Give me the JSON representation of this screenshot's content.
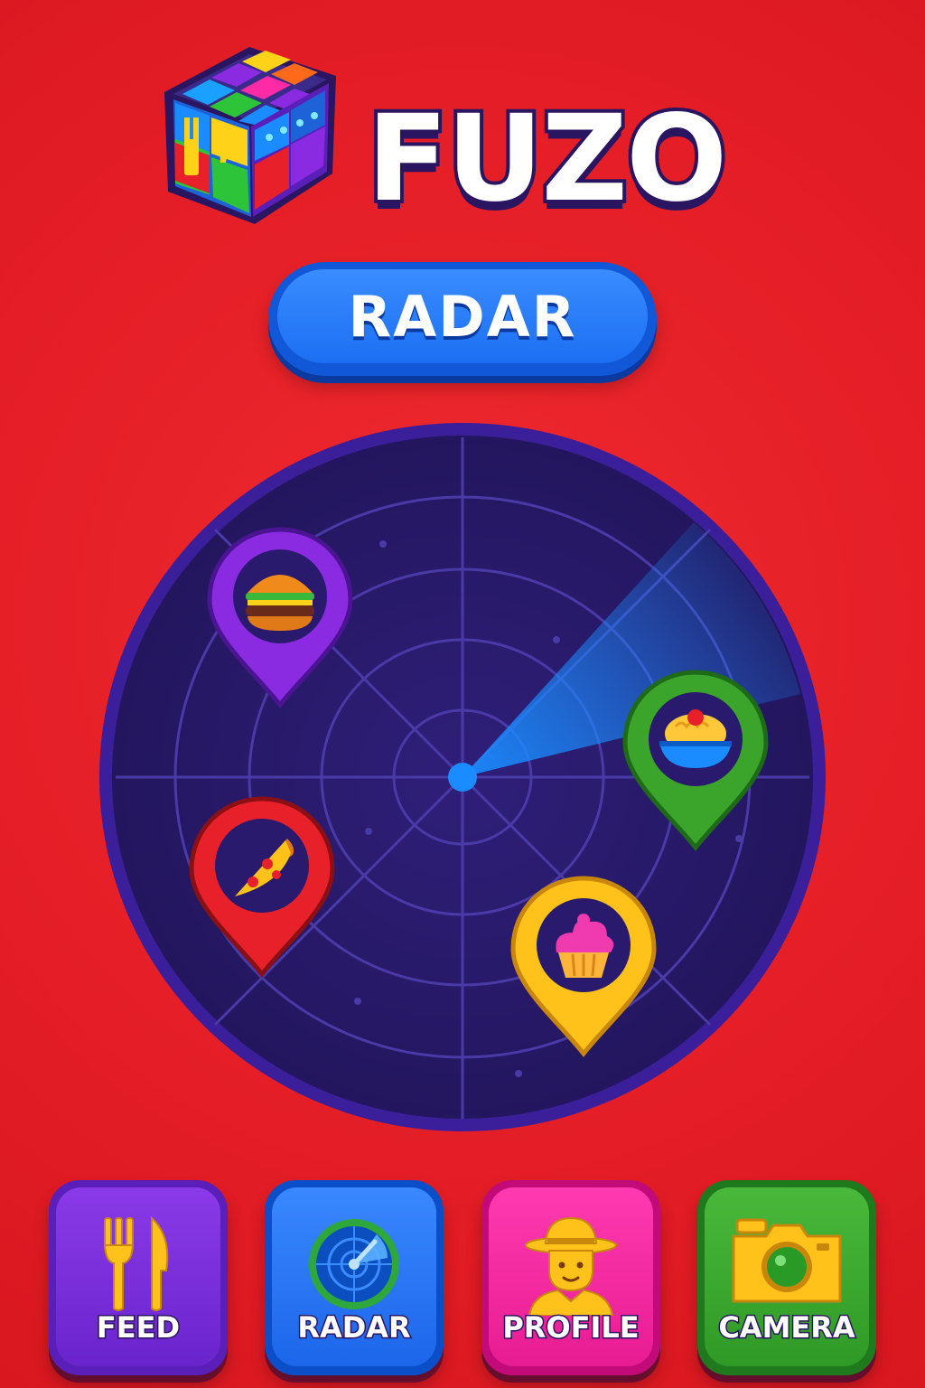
{
  "app": {
    "title": "FUZO"
  },
  "mode_pill": {
    "label": "RADAR"
  },
  "radar": {
    "pins": [
      {
        "name": "burger",
        "icon": "burger-icon",
        "color": "#8a2be2"
      },
      {
        "name": "noodles",
        "icon": "noodle-bowl-icon",
        "color": "#3aa52a"
      },
      {
        "name": "pizza",
        "icon": "pizza-slice-icon",
        "color": "#e8202a"
      },
      {
        "name": "cupcake",
        "icon": "cupcake-icon",
        "color": "#ffc21a"
      }
    ]
  },
  "nav": {
    "items": [
      {
        "label": "FEED",
        "icon": "fork-knife-icon",
        "color": "#7a2ee0"
      },
      {
        "label": "RADAR",
        "icon": "radar-icon",
        "color": "#2a78f4"
      },
      {
        "label": "PROFILE",
        "icon": "explorer-avatar-icon",
        "color": "#f22aa2"
      },
      {
        "label": "CAMERA",
        "icon": "camera-icon",
        "color": "#3ca830"
      }
    ]
  },
  "colors": {
    "background": "#e8202a",
    "radar_dish": "#2a1a6e",
    "accent_blue": "#1c6ff2",
    "outline": "#2a1560"
  }
}
